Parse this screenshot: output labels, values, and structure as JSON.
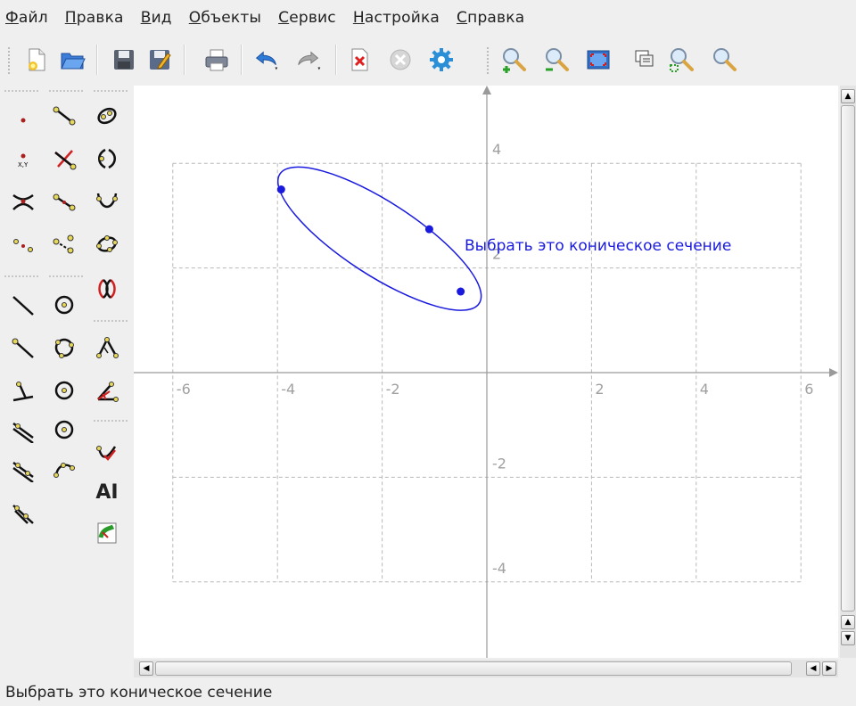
{
  "menubar": {
    "items": [
      {
        "label": "Файл",
        "accel": "Ф",
        "rest": "айл"
      },
      {
        "label": "Правка",
        "accel": "П",
        "rest": "равка"
      },
      {
        "label": "Вид",
        "accel": "В",
        "rest": "ид"
      },
      {
        "label": "Объекты",
        "accel": "О",
        "rest": "бъекты"
      },
      {
        "label": "Сервис",
        "accel": "С",
        "rest": "ервис"
      },
      {
        "label": "Настройка",
        "accel": "Н",
        "rest": "астройка"
      },
      {
        "label": "Справка",
        "accel": "С",
        "rest": "правка"
      }
    ]
  },
  "toolbar": {
    "icons": [
      "new-document-icon",
      "open-folder-icon",
      "save-icon",
      "save-as-icon",
      "print-icon",
      "undo-icon",
      "redo-icon",
      "delete-icon",
      "cancel-icon",
      "settings-icon",
      "zoom-in-icon",
      "zoom-out-icon",
      "fit-to-screen-icon",
      "zoom-rect-icon",
      "zoom-area-icon",
      "zoom-icon"
    ]
  },
  "objects_toolbar": {
    "icons": [
      "point-icon",
      "segment-icon",
      "conic-icon",
      "point-by-coordinates-icon",
      "intersection-point-icon",
      "parabola-icon",
      "hyperbola-point-icon",
      "midpoint-icon",
      "cubic-icon",
      "points-icon",
      "move-point-icon",
      "conic-by-points-icon",
      "arc-conic-icon",
      "line-icon",
      "circle-icon",
      "ray-icon",
      "circle-by-three-points-icon",
      "polygon-icon",
      "perpendicular-icon",
      "circle-by-center-icon",
      "angle-icon",
      "parallel-icon",
      "circle-by-radius-icon",
      "vector-icon",
      "parallel-vector-icon",
      "arc-icon",
      "text-label-icon",
      "translation-icon",
      "script-icon"
    ],
    "text_tool_label": "AI"
  },
  "canvas": {
    "x_ticks": [
      "-6",
      "-4",
      "-2",
      "2",
      "4",
      "6"
    ],
    "y_ticks": [
      "4",
      "2",
      "-2",
      "-4"
    ],
    "hover_label": "Выбрать это коническое сечение",
    "conic": {
      "type": "ellipse",
      "center": [
        -2.05,
        2.56
      ],
      "semi_axes": [
        2.27,
        0.7
      ],
      "angle_deg": -33,
      "points": [
        [
          -3.93,
          3.5
        ],
        [
          -1.1,
          2.74
        ],
        [
          -0.5,
          1.55
        ]
      ]
    },
    "accent_color": "#1a1adf"
  },
  "status": {
    "text": "Выбрать это коническое сечение"
  }
}
